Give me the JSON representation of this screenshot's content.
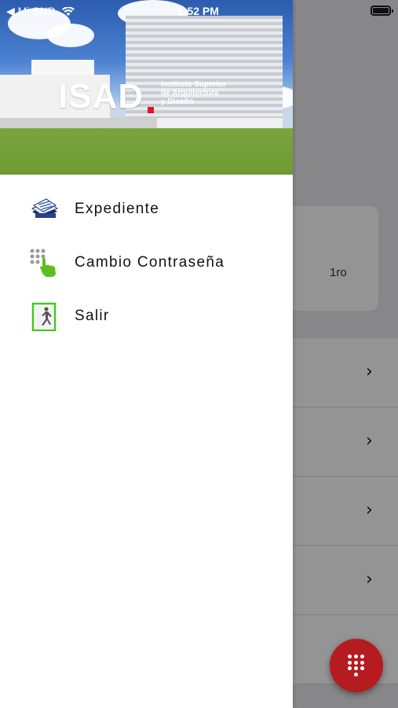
{
  "status_bar": {
    "carrier": "◀ Mi SND",
    "time": "1:52 PM"
  },
  "drawer": {
    "logo": {
      "name": "ISAD",
      "subtitle": "Instituto Superior\nde Arquitectura\ny Diseño"
    },
    "menu": [
      {
        "label": "Expediente",
        "icon": "records-icon"
      },
      {
        "label": "Cambio Contraseña",
        "icon": "keypad-touch-icon"
      },
      {
        "label": "Salir",
        "icon": "exit-icon"
      }
    ]
  },
  "background": {
    "card_text": "1ro",
    "rows": [
      "›",
      "›",
      "›",
      "›",
      "›"
    ],
    "fab_color": "#b51b1f"
  }
}
